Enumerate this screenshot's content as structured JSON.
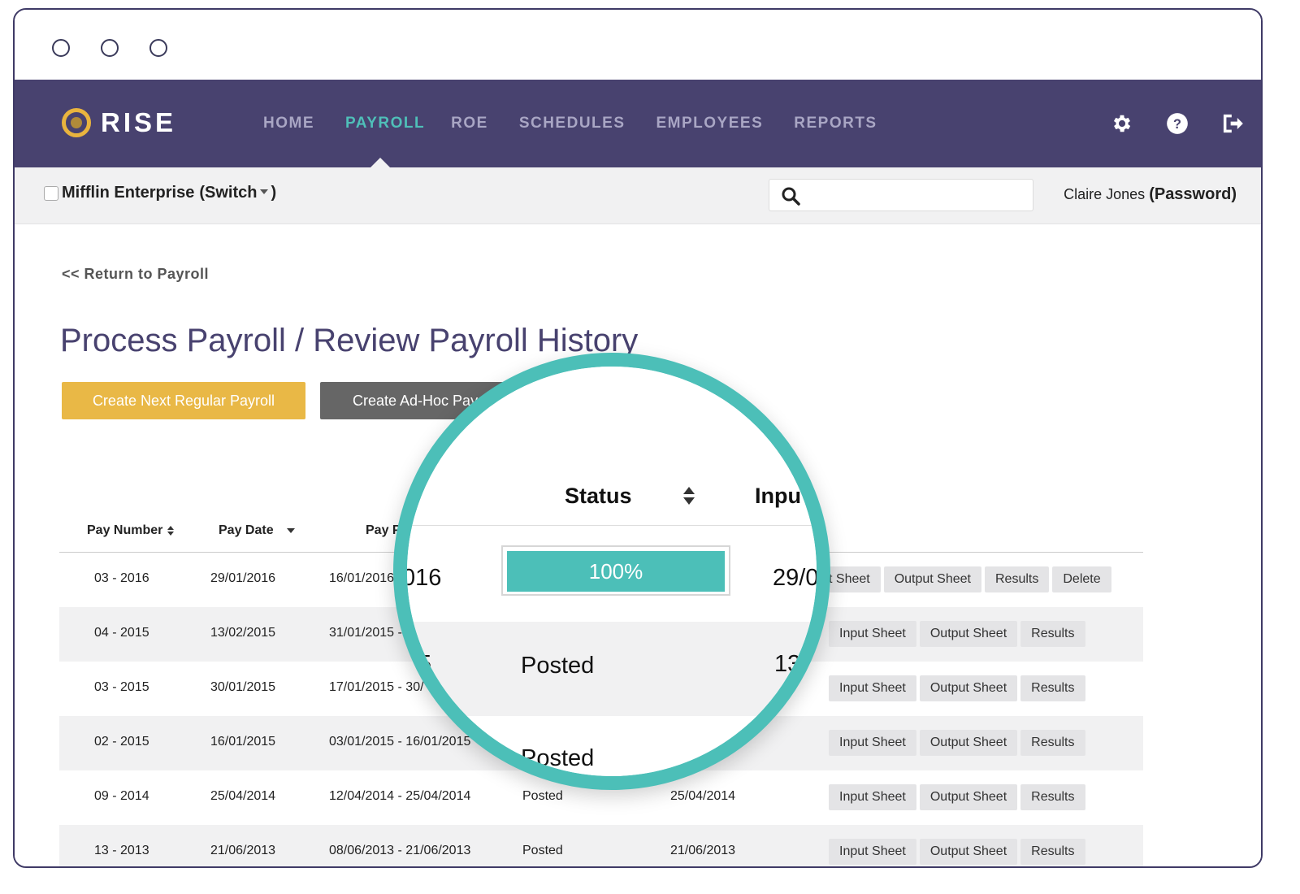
{
  "window": {
    "controls": [
      "window-dot",
      "window-dot",
      "window-dot"
    ]
  },
  "brand": {
    "name": "RISE",
    "accent": "#e9b43e",
    "nav_bg": "#48426f",
    "teal": "#4cbfb8"
  },
  "nav": {
    "items": [
      {
        "label": "HOME",
        "active": false
      },
      {
        "label": "PAYROLL",
        "active": true
      },
      {
        "label": "ROE",
        "active": false
      },
      {
        "label": "SCHEDULES",
        "active": false
      },
      {
        "label": "EMPLOYEES",
        "active": false
      },
      {
        "label": "REPORTS",
        "active": false
      }
    ],
    "icons": [
      "gear-icon",
      "help-icon",
      "logout-icon"
    ]
  },
  "subbar": {
    "company": "Mifflin Enterprise",
    "switch_label": "(Switch",
    "switch_close": ")",
    "search_placeholder": "",
    "user_name": "Claire Jones",
    "password_link": "(Password)"
  },
  "page": {
    "return_link": "<< Return to Payroll",
    "title": "Process Payroll / Review Payroll History",
    "primary_button": "Create Next Regular Payroll",
    "secondary_button": "Create Ad-Hoc Pay"
  },
  "table": {
    "headers": {
      "pay_number": "Pay Number",
      "pay_date": "Pay Date",
      "pay_period": "Pay P"
    },
    "rows": [
      {
        "pay_number": "03 - 2016",
        "pay_date": "29/01/2016",
        "period": "16/01/2016",
        "status": "",
        "input": "",
        "actions": [
          "t Sheet",
          "Output Sheet",
          "Results",
          "Delete"
        ]
      },
      {
        "pay_number": "04 - 2015",
        "pay_date": "13/02/2015",
        "period": "31/01/2015 -",
        "status": "",
        "input": "",
        "actions": [
          "Input Sheet",
          "Output Sheet",
          "Results"
        ]
      },
      {
        "pay_number": "03 - 2015",
        "pay_date": "30/01/2015",
        "period": "17/01/2015 - 30/",
        "status": "",
        "input": "",
        "actions": [
          "Input Sheet",
          "Output Sheet",
          "Results"
        ]
      },
      {
        "pay_number": "02 - 2015",
        "pay_date": "16/01/2015",
        "period": "03/01/2015 - 16/01/2015",
        "status": "",
        "input": "",
        "actions": [
          "Input Sheet",
          "Output Sheet",
          "Results"
        ]
      },
      {
        "pay_number": "09 - 2014",
        "pay_date": "25/04/2014",
        "period": "12/04/2014 - 25/04/2014",
        "status": "Posted",
        "input": "25/04/2014",
        "actions": [
          "Input Sheet",
          "Output Sheet",
          "Results"
        ]
      },
      {
        "pay_number": "13 - 2013",
        "pay_date": "21/06/2013",
        "period": "08/06/2013 - 21/06/2013",
        "status": "Posted",
        "input": "21/06/2013",
        "actions": [
          "Input Sheet",
          "Output Sheet",
          "Results"
        ]
      }
    ]
  },
  "magnifier": {
    "header_status": "Status",
    "header_input": "Inpu",
    "row1_left": "016",
    "row1_progress_label": "100%",
    "row1_progress_value": 1.0,
    "row1_input": "29/0",
    "row2_left": "5",
    "row2_status": "Posted",
    "row2_input": "13",
    "row3_status": "Posted"
  }
}
